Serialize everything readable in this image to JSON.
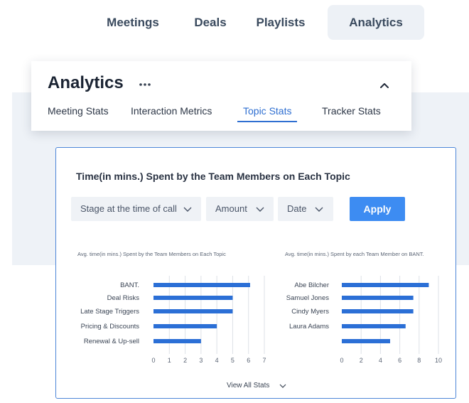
{
  "nav": {
    "items": [
      {
        "label": "Meetings",
        "active": false
      },
      {
        "label": "Deals",
        "active": false
      },
      {
        "label": "Playlists",
        "active": false
      },
      {
        "label": "Analytics",
        "active": true
      }
    ]
  },
  "analytics": {
    "title": "Analytics",
    "more_icon": "more-horizontal-icon",
    "collapse_icon": "chevron-up-icon",
    "tabs": [
      {
        "label": "Meeting Stats",
        "active": false
      },
      {
        "label": "Interaction Metrics",
        "active": false
      },
      {
        "label": "Topic Stats",
        "active": true
      },
      {
        "label": "Tracker Stats",
        "active": false
      }
    ]
  },
  "panel": {
    "title": "Time(in mins.) Spent by the Team Members on Each Topic",
    "filters": [
      {
        "label": "Stage at the time of call",
        "icon": "chevron-down-icon"
      },
      {
        "label": "Amount",
        "icon": "chevron-down-icon"
      },
      {
        "label": "Date",
        "icon": "chevron-down-icon"
      }
    ],
    "apply_label": "Apply",
    "view_all_label": "View All Stats"
  },
  "colors": {
    "accent": "#2f6fd1",
    "bar": "#2b6fd6",
    "apply_bg": "#3d8cf2",
    "panel_border": "#4d86d8"
  },
  "chart_data": [
    {
      "type": "bar",
      "orientation": "horizontal",
      "title": "Avg. time(in mins.) Spent by the Team Members on Each Topic",
      "categories": [
        "BANT.",
        "Deal Risks",
        "Late Stage Triggers",
        "Pricing & Discounts",
        "Renewal & Up-sell"
      ],
      "values": [
        6.1,
        5.0,
        5.0,
        4.0,
        3.0
      ],
      "xlim": [
        0,
        7
      ],
      "xticks": [
        0,
        1,
        2,
        3,
        4,
        5,
        6,
        7
      ],
      "grid": true
    },
    {
      "type": "bar",
      "orientation": "horizontal",
      "title": "Avg. time(in mins.) Spent by each Team Member on BANT.",
      "categories": [
        "Abe Bilcher",
        "Samuel Jones",
        "Cindy Myers",
        "Laura Adams",
        ""
      ],
      "values": [
        9.0,
        7.4,
        7.4,
        6.6,
        5.0
      ],
      "xlim": [
        0,
        10
      ],
      "xticks": [
        0,
        2,
        4,
        6,
        8,
        10
      ],
      "grid": true
    }
  ]
}
